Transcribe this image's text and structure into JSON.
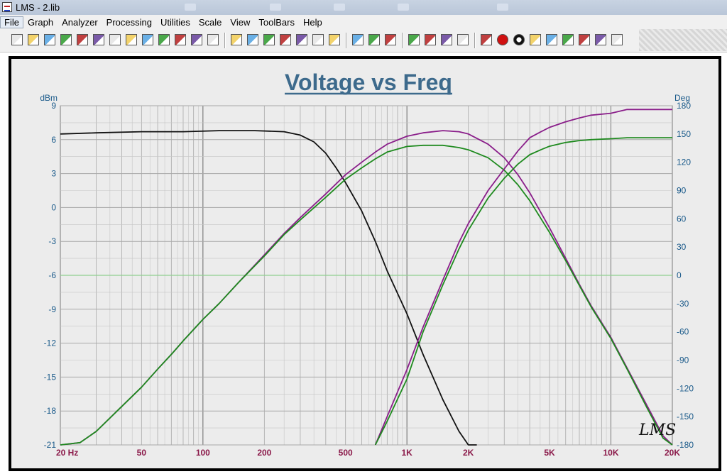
{
  "window": {
    "title": "LMS - 2.lib"
  },
  "menu": [
    "File",
    "Graph",
    "Analyzer",
    "Processing",
    "Utilities",
    "Scale",
    "View",
    "ToolBars",
    "Help"
  ],
  "toolbar": {
    "groups": [
      [
        "new-icon",
        "open-icon",
        "open-folder-icon",
        "save-disabled-icon",
        "save-icon",
        "import-icon",
        "export-icon",
        "open-library-icon",
        "save-library-icon",
        "print-preview-icon",
        "print-icon",
        "notes-icon",
        "erase-icon"
      ],
      [
        "zoom-in-icon",
        "zoom-out-icon",
        "scale-1-icon",
        "scale-2-icon",
        "scale-3-icon",
        "scale-4-icon",
        "grid-icon"
      ],
      [
        "overlay-icon",
        "curve-library-icon",
        "calculator-icon"
      ],
      [
        "marker-icon",
        "cursor-icon",
        "cursor-2-icon",
        "cursor-3-icon"
      ],
      [
        "rack-icon",
        "record-icon",
        "stop-icon",
        "spectrum-icon",
        "probe-icon",
        "wizard-icon",
        "macro-icon",
        "settings-icon",
        "hand-icon"
      ]
    ]
  },
  "chart_data": {
    "type": "line",
    "title": "Voltage vs Freq",
    "xscale": "log",
    "xlim": [
      20,
      20000
    ],
    "ylim_left": [
      -21,
      9
    ],
    "ylim_right": [
      -180,
      180
    ],
    "ylabel_left": "dBm",
    "ylabel_right": "Deg",
    "x_ticks": [
      {
        "value": 20,
        "label": "20 Hz"
      },
      {
        "value": 50,
        "label": "50"
      },
      {
        "value": 100,
        "label": "100"
      },
      {
        "value": 200,
        "label": "200"
      },
      {
        "value": 500,
        "label": "500"
      },
      {
        "value": 1000,
        "label": "1K"
      },
      {
        "value": 2000,
        "label": "2K"
      },
      {
        "value": 5000,
        "label": "5K"
      },
      {
        "value": 10000,
        "label": "10K"
      },
      {
        "value": 20000,
        "label": "20K"
      }
    ],
    "y_ticks_left": [
      "9",
      "6",
      "3",
      "0",
      "-3",
      "-6",
      "-9",
      "-12",
      "-15",
      "-18",
      "-21"
    ],
    "y_ticks_right": [
      "180",
      "150",
      "120",
      "90",
      "60",
      "30",
      "0",
      "-30",
      "-60",
      "-90",
      "-120",
      "-150",
      "-180"
    ],
    "grid": true,
    "logo": "LMS",
    "colors": {
      "background": "#ececec",
      "grid": "#a8a8a8",
      "zero_line": "#90d090"
    },
    "series": [
      {
        "color": "#111111",
        "axis": "left",
        "x": [
          20,
          30,
          50,
          80,
          120,
          180,
          250,
          300,
          350,
          400,
          450,
          500,
          600,
          700,
          800,
          1000,
          1200,
          1500,
          1800,
          2000,
          2200
        ],
        "y": [
          6.5,
          6.6,
          6.7,
          6.7,
          6.8,
          6.8,
          6.7,
          6.4,
          5.8,
          4.8,
          3.5,
          2.2,
          -0.3,
          -3.0,
          -5.6,
          -9.4,
          -13.0,
          -17.0,
          -19.8,
          -21.0,
          -21.5
        ]
      },
      {
        "color": "#8a1e8a",
        "axis": "left",
        "x": [
          20,
          25,
          30,
          40,
          50,
          60,
          70,
          80,
          100,
          120,
          150,
          200,
          250,
          300,
          400,
          500,
          600,
          700,
          800,
          1000,
          1200,
          1500,
          1800,
          2000,
          2500,
          3000,
          3500,
          4000,
          5000,
          6000,
          7000,
          8000,
          10000,
          12000,
          15000,
          18000,
          20000
        ],
        "y": [
          -21.5,
          -20.8,
          -19.8,
          -17.6,
          -15.9,
          -14.3,
          -13.0,
          -11.8,
          -9.9,
          -8.5,
          -6.6,
          -4.2,
          -2.3,
          -0.9,
          1.2,
          2.9,
          4.0,
          4.9,
          5.6,
          6.3,
          6.6,
          6.8,
          6.7,
          6.5,
          5.6,
          4.4,
          2.9,
          1.3,
          -1.8,
          -4.5,
          -6.8,
          -8.7,
          -11.5,
          -14.2,
          -17.5,
          -20.2,
          -21.5
        ]
      },
      {
        "color": "#1e8a1e",
        "axis": "left",
        "x": [
          20,
          25,
          30,
          40,
          50,
          60,
          70,
          80,
          100,
          120,
          150,
          200,
          250,
          300,
          400,
          500,
          600,
          700,
          800,
          1000,
          1200,
          1500,
          1800,
          2000,
          2500,
          3000,
          3500,
          4000,
          5000,
          6000,
          7000,
          8000,
          10000,
          12000,
          15000,
          18000,
          20000
        ],
        "y": [
          -21.5,
          -20.8,
          -19.8,
          -17.6,
          -15.9,
          -14.3,
          -13.0,
          -11.8,
          -9.9,
          -8.5,
          -6.6,
          -4.3,
          -2.4,
          -1.1,
          0.9,
          2.5,
          3.5,
          4.3,
          4.9,
          5.4,
          5.5,
          5.5,
          5.3,
          5.1,
          4.4,
          3.3,
          2.0,
          0.6,
          -2.2,
          -4.7,
          -6.9,
          -8.8,
          -11.6,
          -14.3,
          -17.7,
          -20.4,
          -21.7
        ]
      },
      {
        "color": "#8a1e8a",
        "axis": "right",
        "x": [
          700,
          800,
          1000,
          1200,
          1500,
          1800,
          2000,
          2500,
          3000,
          3500,
          4000,
          4500,
          5000,
          6000,
          7000,
          8000,
          10000,
          12000,
          15000,
          18000,
          20000
        ],
        "y": [
          -180,
          -150,
          -100,
          -55,
          -5,
          35,
          55,
          90,
          113,
          132,
          146,
          152,
          157,
          163,
          167,
          170,
          172,
          176,
          176,
          176,
          176
        ]
      },
      {
        "color": "#1e8a1e",
        "axis": "right",
        "x": [
          700,
          800,
          1000,
          1200,
          1500,
          1800,
          2000,
          2500,
          3000,
          3500,
          4000,
          4500,
          5000,
          6000,
          7000,
          8000,
          10000,
          12000,
          15000,
          18000,
          20000
        ],
        "y": [
          -180,
          -155,
          -110,
          -60,
          -10,
          28,
          48,
          82,
          103,
          118,
          128,
          133,
          137,
          141,
          143,
          144,
          145,
          146,
          146,
          146,
          146
        ]
      }
    ]
  }
}
